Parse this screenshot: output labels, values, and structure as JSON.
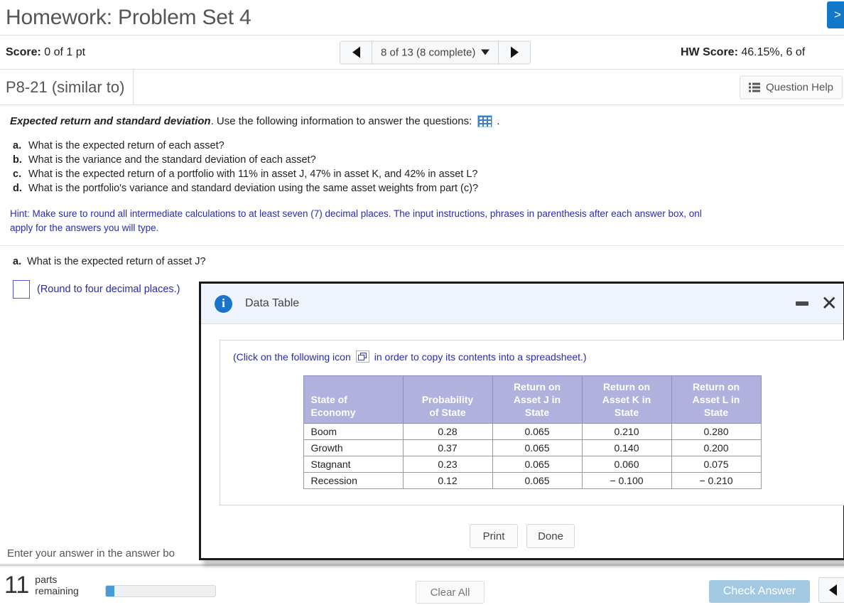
{
  "header": {
    "title": "Homework: Problem Set 4",
    "corner_button_label": ">"
  },
  "scorebar": {
    "score_label": "Score:",
    "score_value": "0 of 1 pt",
    "pager": {
      "prev_icon": "triangle-left-icon",
      "label": "8 of 13 (8 complete)",
      "next_icon": "triangle-right-icon"
    },
    "hw_score_label": "HW Score:",
    "hw_score_value": "46.15%, 6 of "
  },
  "problembar": {
    "problem_id": "P8-21 (similar to)",
    "question_help": "Question Help"
  },
  "question": {
    "intro_bold": "Expected return and standard deviation",
    "intro_rest": ". Use the following information to answer the questions:",
    "intro_tail": ".",
    "items": [
      {
        "label": "a.",
        "text": "What is the expected return of each asset?"
      },
      {
        "label": "b.",
        "text": "What is the variance and the standard deviation of each asset?"
      },
      {
        "label": "c.",
        "text": "What is the expected return of a portfolio with 11% in asset J, 47% in asset K, and 42% in asset L?"
      },
      {
        "label": "d.",
        "text": "What is the portfolio's variance and standard deviation using the same asset weights from part (c)?"
      }
    ],
    "hint_line1": "Hint: Make sure to round all intermediate calculations to at least seven (7) decimal places. The input instructions, phrases in parenthesis after each answer box, onl",
    "hint_line2": "apply for the answers you will type.",
    "part_a_label": "a.",
    "part_a_text": "What is the expected return of asset J?",
    "answer_value": "",
    "answer_note": "(Round to four decimal places.)",
    "enter_answer_text": "Enter your answer in the answer bo"
  },
  "dialog": {
    "title": "Data Table",
    "info_icon_glyph": "i",
    "minimize_icon": "minimize-icon",
    "close_icon": "close-icon",
    "copy_text_before": "(Click on the following icon",
    "copy_text_after": "in order to copy its contents into a spreadsheet.)",
    "table": {
      "headers": [
        "State of\nEconomy",
        "Probability\nof State",
        "Return on\nAsset J in\nState",
        "Return on\nAsset K in\nState",
        "Return on\nAsset L in\nState"
      ],
      "rows": [
        {
          "state": "Boom",
          "probability": "0.28",
          "asset_j": "0.065",
          "asset_k": "0.210",
          "asset_l": "0.280"
        },
        {
          "state": "Growth",
          "probability": "0.37",
          "asset_j": "0.065",
          "asset_k": "0.140",
          "asset_l": "0.200"
        },
        {
          "state": "Stagnant",
          "probability": "0.23",
          "asset_j": "0.065",
          "asset_k": "0.060",
          "asset_l": "0.075"
        },
        {
          "state": "Recession",
          "probability": "0.12",
          "asset_j": "0.065",
          "asset_k": "− 0.100",
          "asset_l": "− 0.210"
        }
      ]
    },
    "print_label": "Print",
    "done_label": "Done"
  },
  "footer": {
    "parts_number": "11",
    "parts_word1": "parts",
    "parts_word2": "remaining",
    "progress_percent": 8,
    "clear_all_label": "Clear All",
    "check_answer_label": "Check Answer",
    "next_icon": "triangle-left-icon"
  },
  "colors": {
    "accent_blue": "#1478c8",
    "table_header": "#b0b1dc",
    "hint_text": "#2a2ab0",
    "check_answer_bg": "#a3c9e2",
    "progress_fill": "#4a9ad6"
  }
}
